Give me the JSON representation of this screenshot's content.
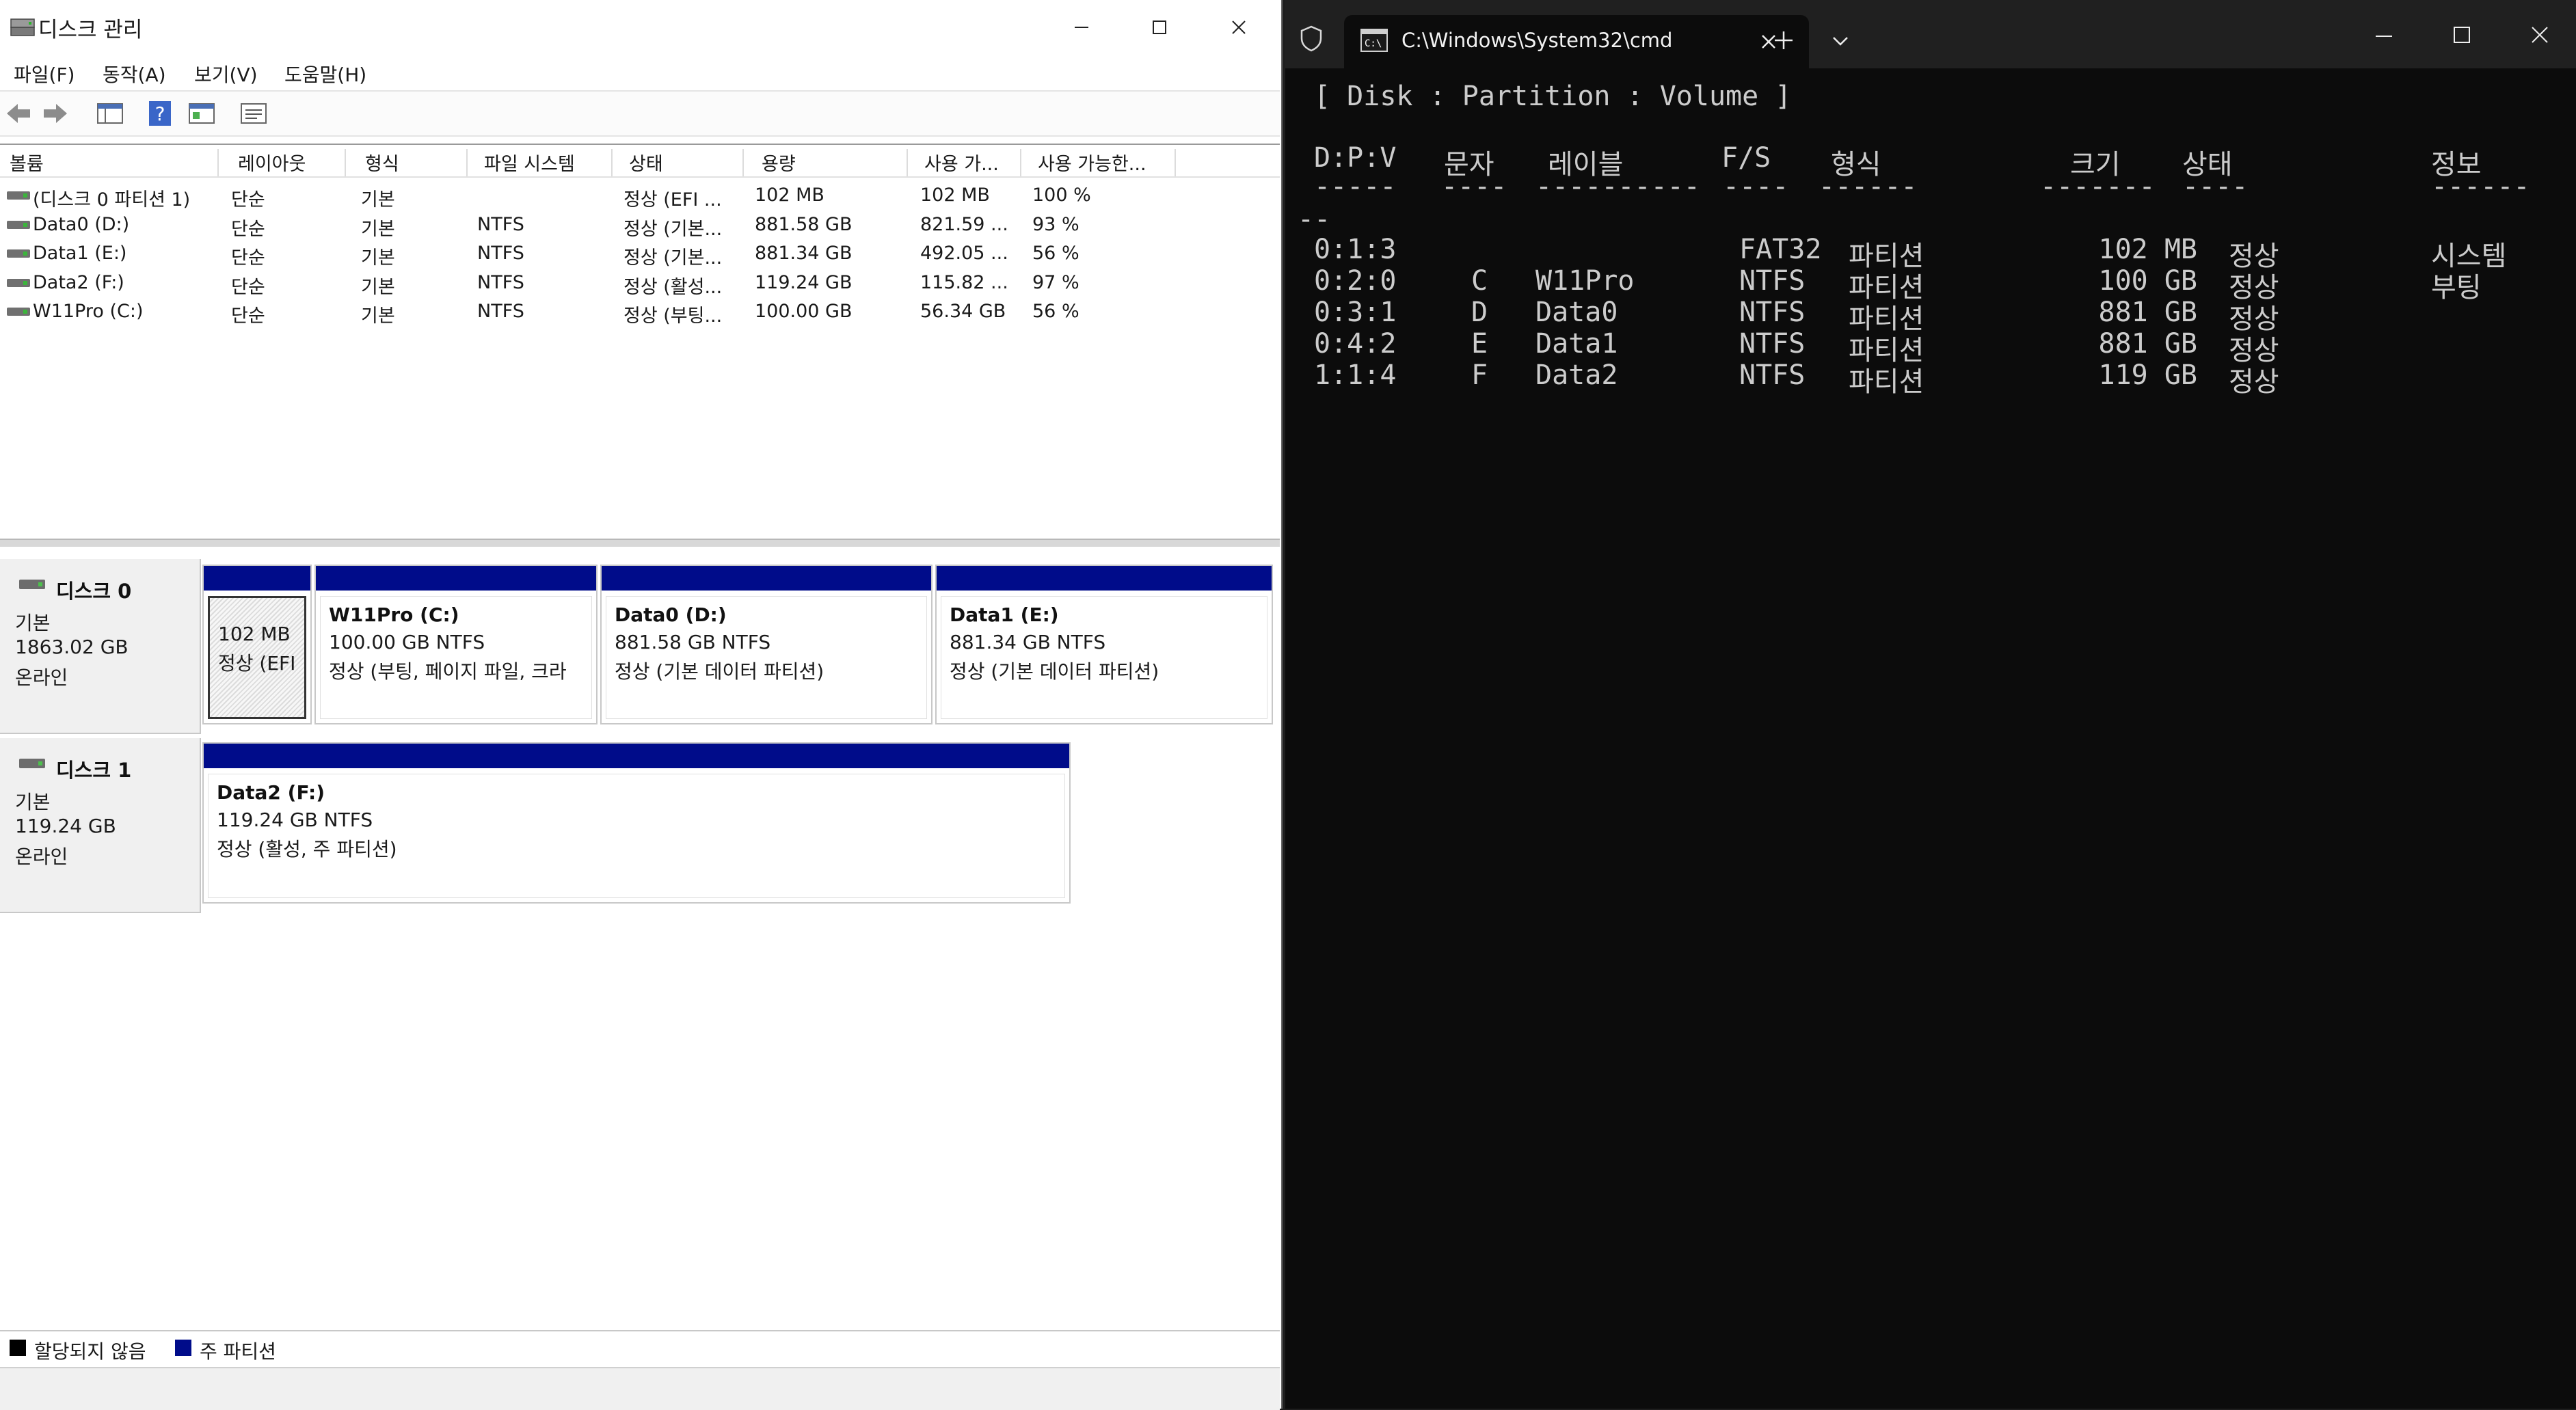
{
  "disk_mgmt": {
    "title": "디스크 관리",
    "menu": [
      "파일(F)",
      "동작(A)",
      "보기(V)",
      "도움말(H)"
    ],
    "columns": [
      "볼륨",
      "레이아웃",
      "형식",
      "파일 시스템",
      "상태",
      "용량",
      "사용 가...",
      "사용 가능한..."
    ],
    "volumes": [
      {
        "name": "(디스크 0 파티션 1)",
        "layout": "단순",
        "type": "기본",
        "fs": "",
        "status": "정상 (EFI ...",
        "capacity": "102 MB",
        "free": "102 MB",
        "pct": "100 %"
      },
      {
        "name": "Data0 (D:)",
        "layout": "단순",
        "type": "기본",
        "fs": "NTFS",
        "status": "정상 (기본...",
        "capacity": "881.58 GB",
        "free": "821.59 ...",
        "pct": "93 %"
      },
      {
        "name": "Data1 (E:)",
        "layout": "단순",
        "type": "기본",
        "fs": "NTFS",
        "status": "정상 (기본...",
        "capacity": "881.34 GB",
        "free": "492.05 ...",
        "pct": "56 %"
      },
      {
        "name": "Data2 (F:)",
        "layout": "단순",
        "type": "기본",
        "fs": "NTFS",
        "status": "정상 (활성...",
        "capacity": "119.24 GB",
        "free": "115.82 ...",
        "pct": "97 %"
      },
      {
        "name": "W11Pro (C:)",
        "layout": "단순",
        "type": "기본",
        "fs": "NTFS",
        "status": "정상 (부팅...",
        "capacity": "100.00 GB",
        "free": "56.34 GB",
        "pct": "56 %"
      }
    ],
    "disks": [
      {
        "name": "디스크 0",
        "kind": "기본",
        "size": "1863.02 GB",
        "state": "온라인",
        "partitions": [
          {
            "title": "",
            "size": "102 MB",
            "state": "정상 (EFI"
          },
          {
            "title": "W11Pro  (C:)",
            "size": "100.00 GB NTFS",
            "state": "정상 (부팅, 페이지 파일, 크라"
          },
          {
            "title": "Data0  (D:)",
            "size": "881.58 GB NTFS",
            "state": "정상 (기본 데이터 파티션)"
          },
          {
            "title": "Data1  (E:)",
            "size": "881.34 GB NTFS",
            "state": "정상 (기본 데이터 파티션)"
          }
        ]
      },
      {
        "name": "디스크 1",
        "kind": "기본",
        "size": "119.24 GB",
        "state": "온라인",
        "partitions": [
          {
            "title": "Data2  (F:)",
            "size": "119.24 GB NTFS",
            "state": "정상 (활성, 주 파티션)"
          }
        ]
      }
    ],
    "legend": {
      "unallocated": "할당되지 않음",
      "primary": "주 파티션",
      "unallocated_color": "#000000",
      "primary_color": "#000c8a"
    }
  },
  "terminal": {
    "tab_title": "C:\\Windows\\System32\\cmd",
    "header_line": "[ Disk : Partition : Volume ]",
    "columns": [
      "D:P:V",
      "문자",
      "레이블",
      "F/S",
      "형식",
      "크기",
      "상태",
      "정보"
    ],
    "dashes": [
      "-----",
      "----",
      "----------",
      "----",
      "------",
      "-------",
      "----",
      "------"
    ],
    "dash_wrap": "--",
    "rows": [
      {
        "dpv": "0:1:3",
        "letter": "",
        "label": "",
        "fs": "FAT32",
        "type": "파티션",
        "size": "102 MB",
        "status": "정상",
        "info": "시스템"
      },
      {
        "dpv": "0:2:0",
        "letter": "C",
        "label": "W11Pro",
        "fs": "NTFS",
        "type": "파티션",
        "size": "100 GB",
        "status": "정상",
        "info": "부팅"
      },
      {
        "dpv": "0:3:1",
        "letter": "D",
        "label": "Data0",
        "fs": "NTFS",
        "type": "파티션",
        "size": "881 GB",
        "status": "정상",
        "info": ""
      },
      {
        "dpv": "0:4:2",
        "letter": "E",
        "label": "Data1",
        "fs": "NTFS",
        "type": "파티션",
        "size": "881 GB",
        "status": "정상",
        "info": ""
      },
      {
        "dpv": "1:1:4",
        "letter": "F",
        "label": "Data2",
        "fs": "NTFS",
        "type": "파티션",
        "size": "119 GB",
        "status": "정상",
        "info": ""
      }
    ]
  }
}
